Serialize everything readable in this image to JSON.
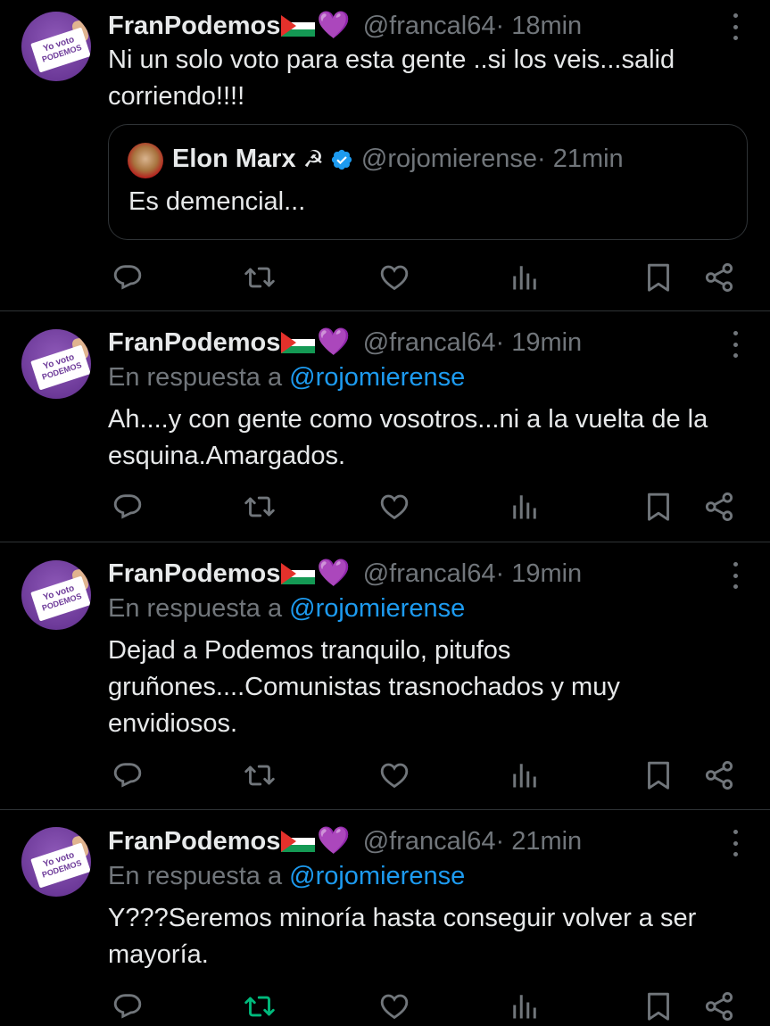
{
  "tweets": [
    {
      "author": "FranPodemos",
      "handle": "@francal64",
      "time": " · 18min",
      "reply_label": "",
      "reply_to": "",
      "text": "Ni  un solo voto para esta gente ..si los veis...salid corriendo!!!!",
      "quote": {
        "author": "Elon Marx",
        "badge_emoji": "☭",
        "handle": "@rojomierense",
        "time": " · 21min",
        "text": "Es demencial..."
      }
    },
    {
      "author": "FranPodemos",
      "handle": "@francal64",
      "time": " · 19min",
      "reply_label": "En respuesta a ",
      "reply_to": "@rojomierense",
      "text": "Ah....y con gente como vosotros...ni a la vuelta de la esquina.Amargados."
    },
    {
      "author": "FranPodemos",
      "handle": "@francal64",
      "time": " · 19min",
      "reply_label": "En respuesta a ",
      "reply_to": "@rojomierense",
      "text": "Dejad a Podemos tranquilo, pitufos gruñones....Comunistas trasnochados y muy envidiosos."
    },
    {
      "author": "FranPodemos",
      "handle": "@francal64",
      "time": " · 21min",
      "reply_label": "En respuesta a ",
      "reply_to": "@rojomierense",
      "text": "Y???Seremos minoría hasta conseguir volver a ser mayoría."
    }
  ],
  "avatar_text": {
    "line1": "Yo voto",
    "line2": "PODEMOS"
  },
  "emoji": {
    "flag": "palestine-flag",
    "heart": "💜"
  },
  "icons": [
    "reply-icon",
    "retweet-icon",
    "like-icon",
    "views-icon",
    "bookmark-icon",
    "share-icon"
  ],
  "colors": {
    "background": "#000000",
    "text": "#e7e9ea",
    "muted": "#71767b",
    "link": "#1d9bf0",
    "border": "#2f3336",
    "verified": "#1d9bf0",
    "heart": "#b169e6",
    "retweet_active": "#00ba7c"
  }
}
